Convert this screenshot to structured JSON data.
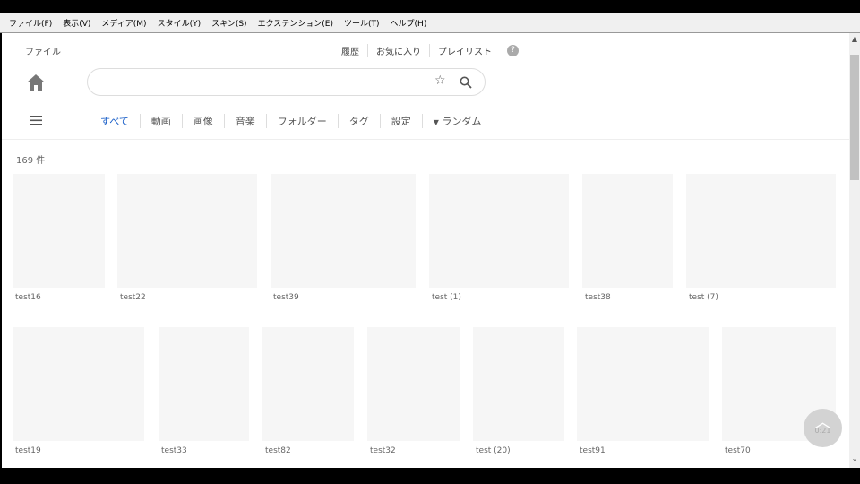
{
  "menu": [
    "ファイル(F)",
    "表示(V)",
    "メディア(M)",
    "スタイル(Y)",
    "スキン(S)",
    "エクステンション(E)",
    "ツール(T)",
    "ヘルプ(H)"
  ],
  "header": {
    "title": "ファイル",
    "links": [
      "履歴",
      "お気に入り",
      "プレイリスト"
    ],
    "help": "?"
  },
  "search": {
    "value": "",
    "placeholder": ""
  },
  "tabs": [
    "すべて",
    "動画",
    "画像",
    "音楽",
    "フォルダー",
    "タグ",
    "設定"
  ],
  "sort": "ランダム",
  "count": "169 件",
  "items": [
    "test16",
    "test22",
    "test39",
    "test (1)",
    "test38",
    "test (7)",
    "test19",
    "test33",
    "test82",
    "test32",
    "test (20)",
    "test91",
    "test70"
  ],
  "fab_time": "0:21"
}
